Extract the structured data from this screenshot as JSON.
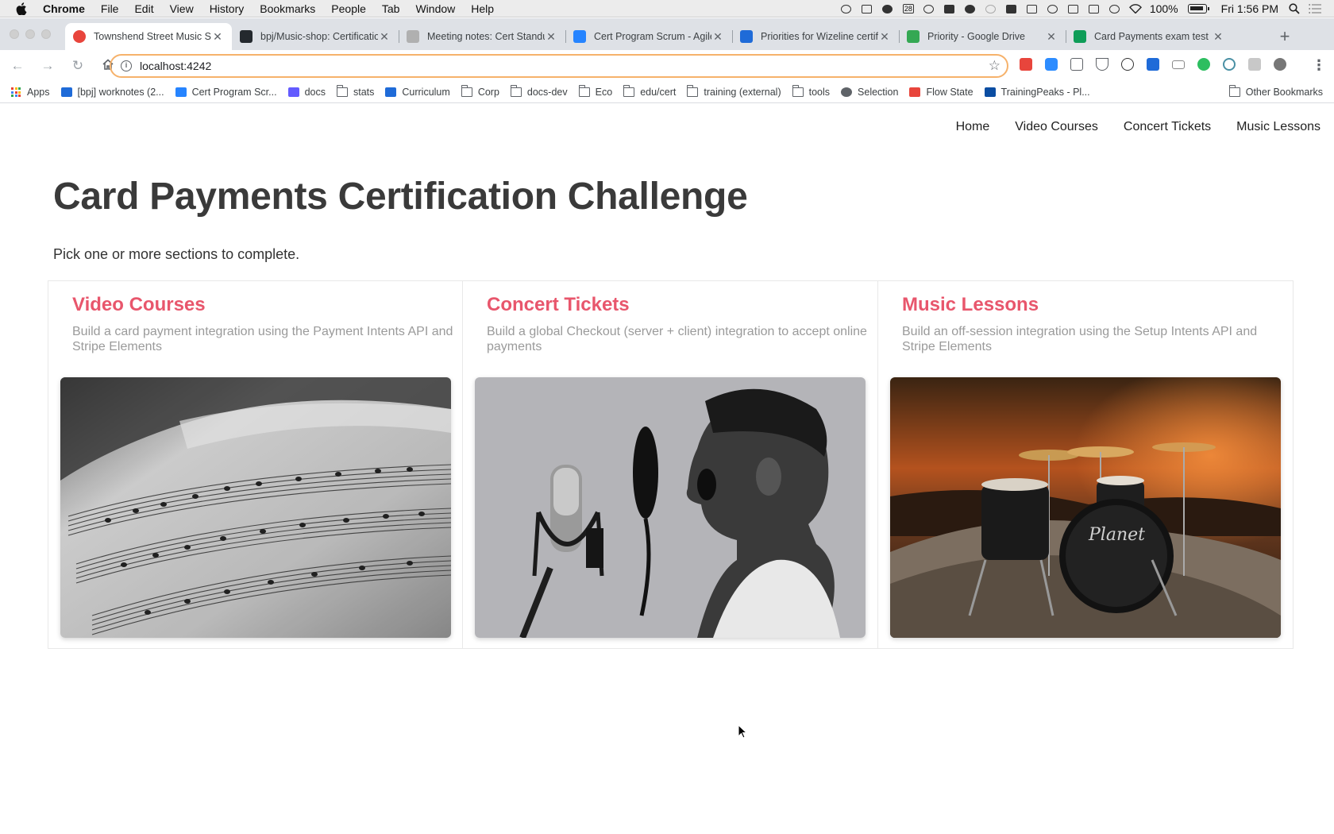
{
  "menubar": {
    "app_name": "Chrome",
    "items": [
      "File",
      "Edit",
      "View",
      "History",
      "Bookmarks",
      "People",
      "Tab",
      "Window",
      "Help"
    ],
    "calendar_day": "28",
    "battery": "100%",
    "clock": "Fri 1:56 PM"
  },
  "tabs": [
    {
      "title": "Townshend Street Music Shop",
      "color": "#e8453c",
      "active": true
    },
    {
      "title": "bpj/Music-shop: Certification",
      "color": "#24292e",
      "active": false
    },
    {
      "title": "Meeting notes: Cert Standup",
      "color": "#b0b0b0",
      "active": false
    },
    {
      "title": "Cert Program Scrum - Agile",
      "color": "#2684ff",
      "active": false
    },
    {
      "title": "Priorities for Wizeline certification",
      "color": "#1f6bd8",
      "active": false
    },
    {
      "title": "Priority - Google Drive",
      "color": "#34a853",
      "active": false
    },
    {
      "title": "Card Payments exam test plan",
      "color": "#0f9d58",
      "active": false
    }
  ],
  "toolbar": {
    "url": "localhost:4242"
  },
  "bookmarks": [
    {
      "label": "Apps",
      "icon": "apps-grid-icon"
    },
    {
      "label": "[bpj] worknotes (2...",
      "icon": "confluence-icon",
      "color": "#1f6bd8"
    },
    {
      "label": "Cert Program Scr...",
      "icon": "jira-icon",
      "color": "#2684ff"
    },
    {
      "label": "docs",
      "icon": "stripe-icon",
      "color": "#635bff"
    },
    {
      "label": "stats",
      "icon": "folder-icon"
    },
    {
      "label": "Curriculum",
      "icon": "confluence-icon",
      "color": "#1f6bd8"
    },
    {
      "label": "Corp",
      "icon": "folder-icon"
    },
    {
      "label": "docs-dev",
      "icon": "folder-icon"
    },
    {
      "label": "Eco",
      "icon": "folder-icon"
    },
    {
      "label": "edu/cert",
      "icon": "folder-icon"
    },
    {
      "label": "training (external)",
      "icon": "folder-icon"
    },
    {
      "label": "tools",
      "icon": "folder-icon"
    },
    {
      "label": "Selection",
      "icon": "globe-icon",
      "color": "#5f6368"
    },
    {
      "label": "Flow State",
      "icon": "flowstate-icon",
      "color": "#e8453c"
    },
    {
      "label": "TrainingPeaks - Pl...",
      "icon": "trainingpeaks-icon",
      "color": "#0b4da2"
    }
  ],
  "other_bookmarks": "Other Bookmarks",
  "site": {
    "nav": [
      "Home",
      "Video Courses",
      "Concert Tickets",
      "Music Lessons"
    ],
    "title": "Card Payments Certification Challenge",
    "subtitle": "Pick one or more sections to complete.",
    "accent": "#e8566c",
    "cards": [
      {
        "title": "Video Courses",
        "description": "Build a card payment integration using the Payment Intents API and Stripe Elements",
        "image": "sheet-music-photo"
      },
      {
        "title": "Concert Tickets",
        "description": "Build a global Checkout (server + client) integration to accept online payments",
        "image": "boy-singing-microphone-photo"
      },
      {
        "title": "Music Lessons",
        "description": "Build an off-session integration using the Setup Intents API and Stripe Elements",
        "image": "drum-kit-sunset-photo"
      }
    ]
  }
}
